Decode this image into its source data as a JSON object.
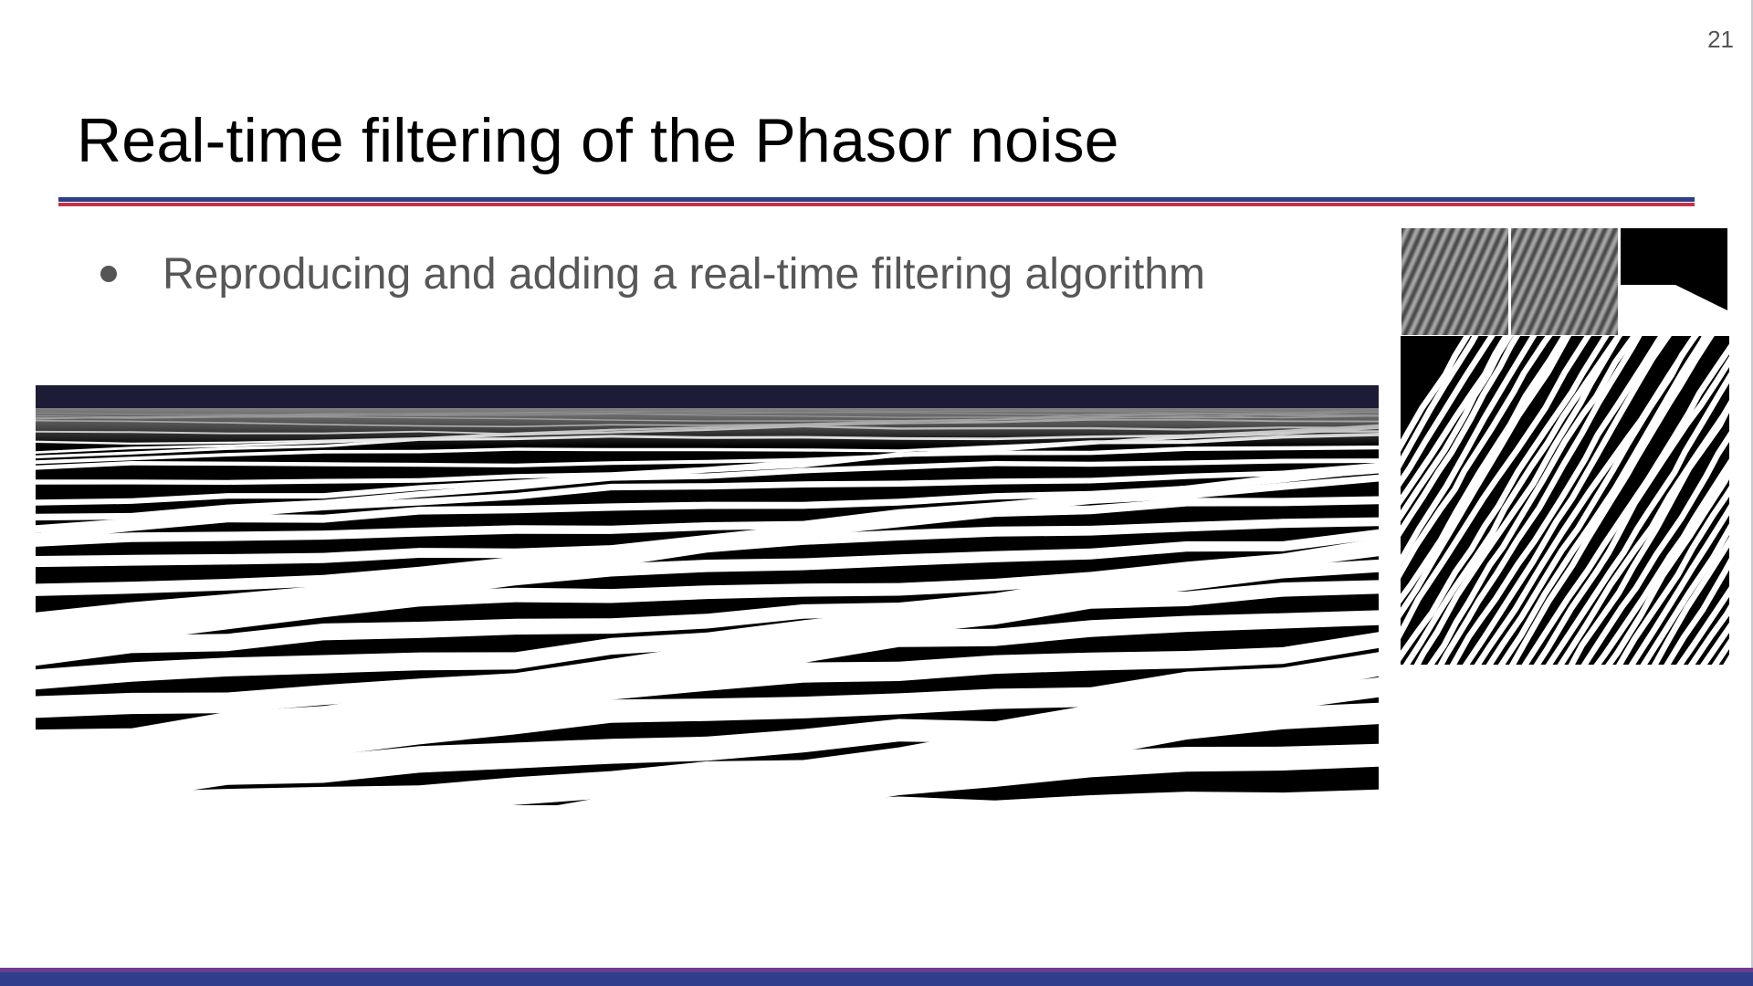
{
  "slide": {
    "page_number": "21",
    "title": "Real-time filtering of the Phasor noise",
    "bullets": [
      {
        "text": "Reproducing and adding a real-time filtering algorithm"
      }
    ]
  },
  "figures": {
    "main": {
      "subject": "phasor-noise-terrain-render"
    },
    "thumbnails": [
      "filtered-noise-a",
      "filtered-noise-b",
      "black-shape-profile"
    ],
    "pattern": {
      "subject": "phasor-noise-binary-pattern"
    }
  },
  "colors": {
    "divider_blue": "#2e3f86",
    "divider_red": "#c3324b",
    "footer_purple": "#6a3f92",
    "footer_blue": "#2f3e8c",
    "sky": "#1c1c36"
  }
}
